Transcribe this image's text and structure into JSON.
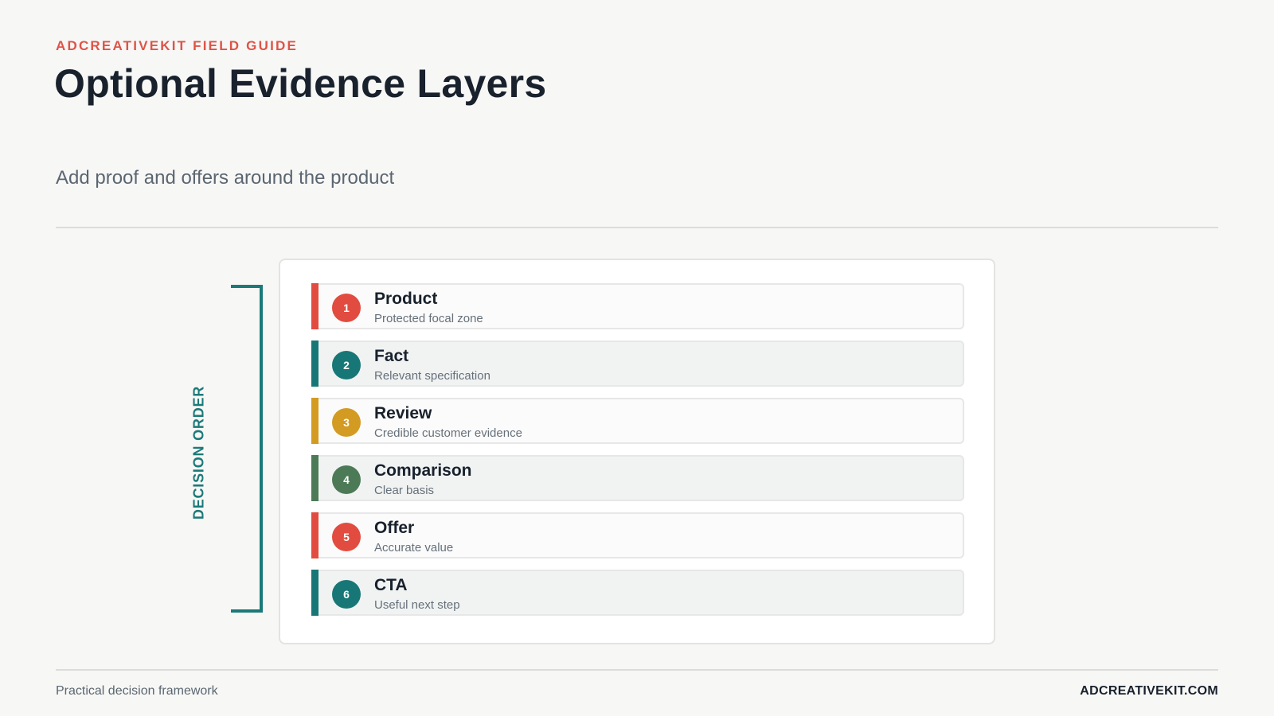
{
  "header": {
    "eyebrow": "ADCREATIVEKIT FIELD GUIDE",
    "title": "Optional Evidence Layers",
    "subtitle": "Add proof and offers around the product"
  },
  "bracket": {
    "label": "DECISION ORDER",
    "color": "#1a7a78"
  },
  "layers": [
    {
      "num": "1",
      "name": "Product",
      "desc": "Protected focal zone",
      "color": "#e24b3f"
    },
    {
      "num": "2",
      "name": "Fact",
      "desc": "Relevant specification",
      "color": "#177776"
    },
    {
      "num": "3",
      "name": "Review",
      "desc": "Credible customer evidence",
      "color": "#d39b22"
    },
    {
      "num": "4",
      "name": "Comparison",
      "desc": "Clear basis",
      "color": "#4c7a56"
    },
    {
      "num": "5",
      "name": "Offer",
      "desc": "Accurate value",
      "color": "#e24b3f"
    },
    {
      "num": "6",
      "name": "CTA",
      "desc": "Useful next step",
      "color": "#177776"
    }
  ],
  "footer": {
    "left": "Practical decision framework",
    "right": "ADCREATIVEKIT.COM"
  }
}
